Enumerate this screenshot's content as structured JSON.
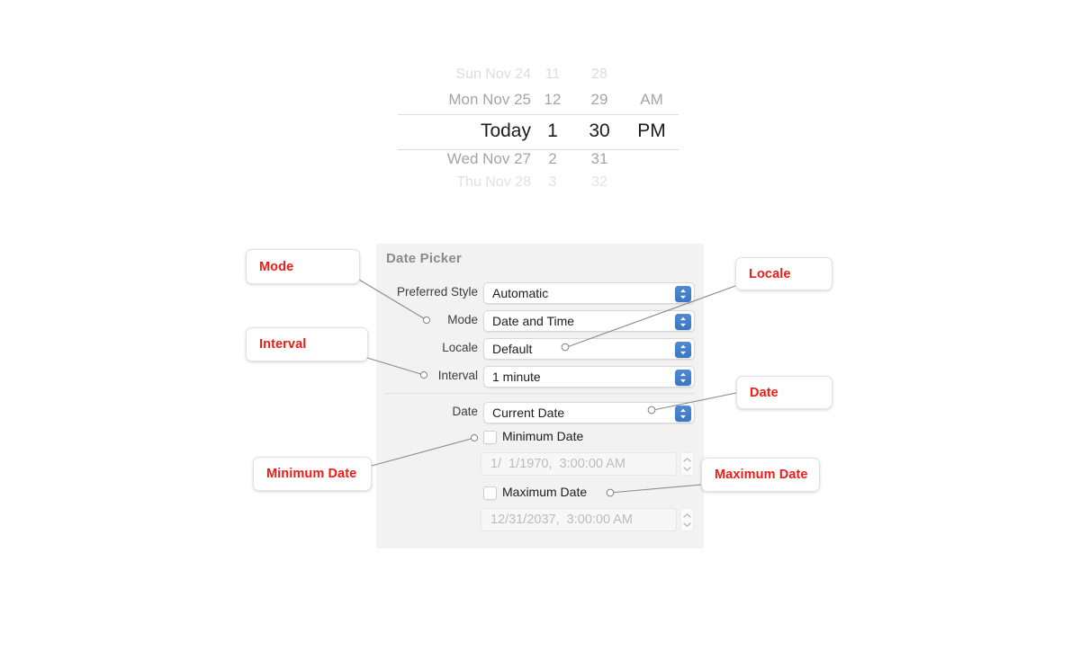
{
  "datepicker": {
    "rows": [
      {
        "day": "Sun Nov 24",
        "hour": "11",
        "minute": "28",
        "ampm": ""
      },
      {
        "day": "Mon Nov 25",
        "hour": "12",
        "minute": "29",
        "ampm": "AM"
      },
      {
        "day": "Today",
        "hour": "1",
        "minute": "30",
        "ampm": "PM"
      },
      {
        "day": "Wed Nov 27",
        "hour": "2",
        "minute": "31",
        "ampm": ""
      },
      {
        "day": "Thu Nov 28",
        "hour": "3",
        "minute": "32",
        "ampm": ""
      }
    ],
    "selected_index": 2
  },
  "inspector": {
    "title": "Date Picker",
    "fields": [
      {
        "label": "Preferred Style",
        "value": "Automatic"
      },
      {
        "label": "Mode",
        "value": "Date and Time"
      },
      {
        "label": "Locale",
        "value": "Default"
      },
      {
        "label": "Interval",
        "value": "1 minute"
      },
      {
        "label": "Date",
        "value": "Current Date"
      }
    ],
    "minimum": {
      "checkbox_label": "Minimum Date",
      "checked": false,
      "date_value": "1/  1/1970,  3:00:00 AM"
    },
    "maximum": {
      "checkbox_label": "Maximum Date",
      "checked": false,
      "date_value": "12/31/2037,  3:00:00 AM"
    }
  },
  "callouts": [
    {
      "label": "Mode"
    },
    {
      "label": "Interval"
    },
    {
      "label": "Minimum Date"
    },
    {
      "label": "Locale"
    },
    {
      "label": "Date"
    },
    {
      "label": "Maximum Date"
    }
  ],
  "colors": {
    "annotation_red": "#f41b16",
    "popup_arrow_blue": "#3d76c4",
    "panel_background": "#f2f2f2"
  }
}
